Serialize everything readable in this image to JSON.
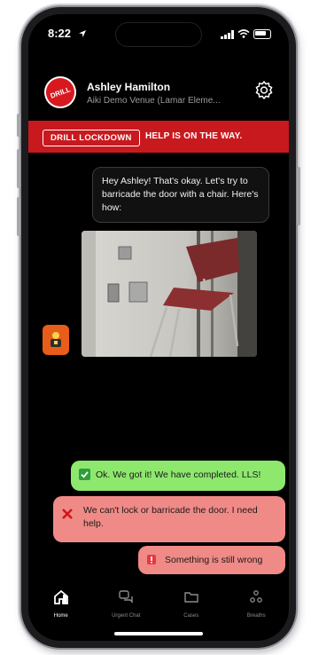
{
  "status": {
    "time": "8:22"
  },
  "header": {
    "user_name": "Ashley Hamilton",
    "venue": "Aiki Demo Venue (Lamar Eleme..."
  },
  "banner": {
    "badge": "DRILL LOCKDOWN",
    "message": "HELP IS ON THE WAY."
  },
  "chat": {
    "incoming": "Hey Ashley! That's okay. Let's try to barricade the door with a chair. Here's how:"
  },
  "replies": [
    {
      "text": "Ok. We got it! We have completed. LLS!",
      "icon": "check-icon"
    },
    {
      "text": "We can't lock or barricade the door. I need help.",
      "icon": "x-icon"
    },
    {
      "text": "Something is still wrong",
      "icon": "alert-icon"
    }
  ],
  "nav": [
    {
      "label": "Home",
      "icon": "home-icon"
    },
    {
      "label": "Urgent Chat",
      "icon": "chat-icon"
    },
    {
      "label": "Cases",
      "icon": "folder-icon"
    },
    {
      "label": "Breaths",
      "icon": "breaths-icon"
    }
  ],
  "colors": {
    "accent_red": "#c8191f",
    "reply_green": "#8ee86e",
    "reply_red": "#f08a86",
    "avatar_orange": "#e85d1a"
  }
}
